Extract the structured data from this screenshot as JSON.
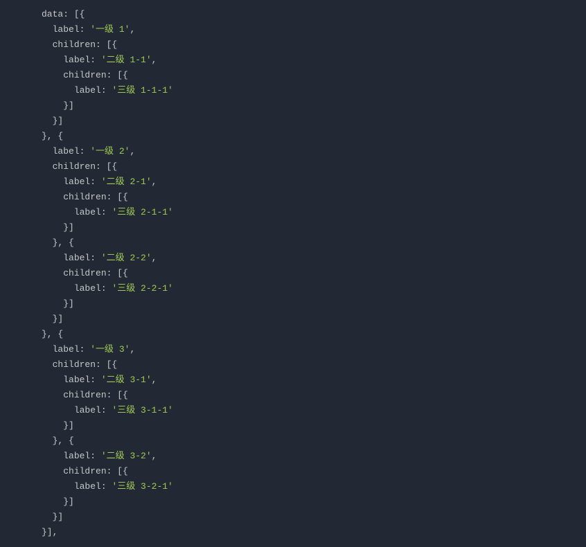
{
  "code": {
    "indent": "  ",
    "key_data": "data",
    "key_label": "label",
    "key_children": "children",
    "open_arr_obj": ": [{",
    "close_obj_arr": "}]",
    "close_obj_open": "}, {",
    "close_arr_trailing": "}],",
    "colon_space": ": ",
    "comma": ",",
    "nodes": {
      "n1": {
        "label": "'一级 1'"
      },
      "n11": {
        "label": "'二级 1-1'"
      },
      "n111": {
        "label": "'三级 1-1-1'"
      },
      "n2": {
        "label": "'一级 2'"
      },
      "n21": {
        "label": "'二级 2-1'"
      },
      "n211": {
        "label": "'三级 2-1-1'"
      },
      "n22": {
        "label": "'二级 2-2'"
      },
      "n221": {
        "label": "'三级 2-2-1'"
      },
      "n3": {
        "label": "'一级 3'"
      },
      "n31": {
        "label": "'二级 3-1'"
      },
      "n311": {
        "label": "'三级 3-1-1'"
      },
      "n32": {
        "label": "'二级 3-2'"
      },
      "n321": {
        "label": "'三级 3-2-1'"
      }
    }
  }
}
